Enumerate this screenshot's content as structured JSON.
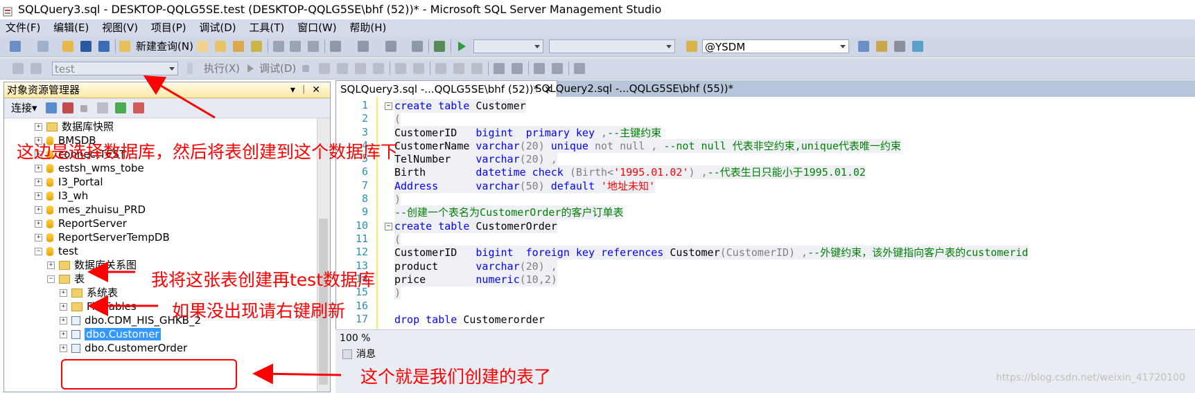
{
  "window": {
    "title": "SQLQuery3.sql - DESKTOP-QQLG5SE.test (DESKTOP-QQLG5SE\\bhf (52))* - Microsoft SQL Server Management Studio"
  },
  "menu": [
    "文件(F)",
    "编辑(E)",
    "视图(V)",
    "项目(P)",
    "调试(D)",
    "工具(T)",
    "窗口(W)",
    "帮助(H)"
  ],
  "toolbar1": {
    "new_query": "新建查询(N)",
    "server_combo": "@YSDM"
  },
  "toolbar2": {
    "database": "test",
    "execute": "执行(X)",
    "debug": "调试(D)"
  },
  "explorer": {
    "title": "对象资源管理器",
    "connect": "连接",
    "nodes": {
      "snapshots": "数据库快照",
      "bmsdb": "BMSDB",
      "connecttest": "connectTEST",
      "estsh": "estsh_wms_tobe",
      "portal": "I3_Portal",
      "wh": "I3_wh",
      "mes": "mes_zhuisu_PRD",
      "reportserver": "ReportServer",
      "reporttemp": "ReportServerTempDB",
      "test": "test",
      "diagrams": "数据库关系图",
      "tables": "表",
      "systables": "系统表",
      "filetables": "FileTables",
      "cdm": "dbo.CDM_HIS_GHKB_2",
      "customer": "dbo.Customer",
      "customerorder": "dbo.CustomerOrder"
    }
  },
  "tabs": [
    {
      "label": "SQLQuery3.sql -...QQLG5SE\\bhf (52))*",
      "active": true
    },
    {
      "label": "SQLQuery2.sql -...QQLG5SE\\bhf (55))*",
      "active": false
    }
  ],
  "code": {
    "l1a": "create table",
    "l1b": " Customer",
    "l2": "(",
    "l3a": "CustomerID   ",
    "l3b": "bigint  primary key",
    "l3c": " ,",
    "l3d": "--主键约束",
    "l4a": "CustomerName ",
    "l4b": "varchar",
    "l4c": "(20)",
    "l4d": " unique",
    "l4e": " not null ,",
    "l4f": " --not null 代表非空约束,unique代表唯一约束",
    "l5a": "TelNumber    ",
    "l5b": "varchar",
    "l5c": "(20) ,",
    "l6a": "Birth        ",
    "l6b": "datetime check",
    "l6c": " (Birth<",
    "l6d": "'1995.01.02'",
    "l6e": ") ,",
    "l6f": "--代表生日只能小于1995.01.02",
    "l7a": "Address      ",
    "l7b": "varchar",
    "l7c": "(50)",
    "l7d": " default",
    "l7e": " '地址未知'",
    "l8": ")",
    "l9": "--创建一个表名为CustomerOrder的客户订单表",
    "l10a": "create table",
    "l10b": " CustomerOrder",
    "l11": "(",
    "l12a": "CustomerID   ",
    "l12b": "bigint  foreign key references",
    "l12c": " Customer",
    "l12d": "(CustomerID) ,",
    "l12e": "--外键约束，该外键指向客户表的customerid",
    "l13a": "product      ",
    "l13b": "varchar",
    "l13c": "(20) ,",
    "l14a": "price        ",
    "l14b": "numeric",
    "l14c": "(10,2)",
    "l15": ")",
    "l17a": "drop table",
    "l17b": " Customerorder"
  },
  "line_numbers": [
    "1",
    "2",
    "3",
    "4",
    "5",
    "6",
    "7",
    "8",
    "9",
    "10",
    "11",
    "12",
    "13",
    "14",
    "15",
    "16",
    "17"
  ],
  "status": {
    "zoom": "100 %",
    "messages_tab": "消息"
  },
  "annotations": {
    "a1": "这边是选择数据库，然后将表创建到这个数据库下",
    "a2": "我将这张表创建再test数据库",
    "a3": "如果没出现请右键刷新",
    "a4": "这个就是我们创建的表了"
  },
  "watermark": "https://blog.csdn.net/weixin_41720100",
  "colors": {
    "annotation": "#ff0000",
    "keyword": "#0000ff",
    "comment": "#008000",
    "string": "#ff0000",
    "line_number": "#2b91af",
    "selection": "#3399ff"
  }
}
